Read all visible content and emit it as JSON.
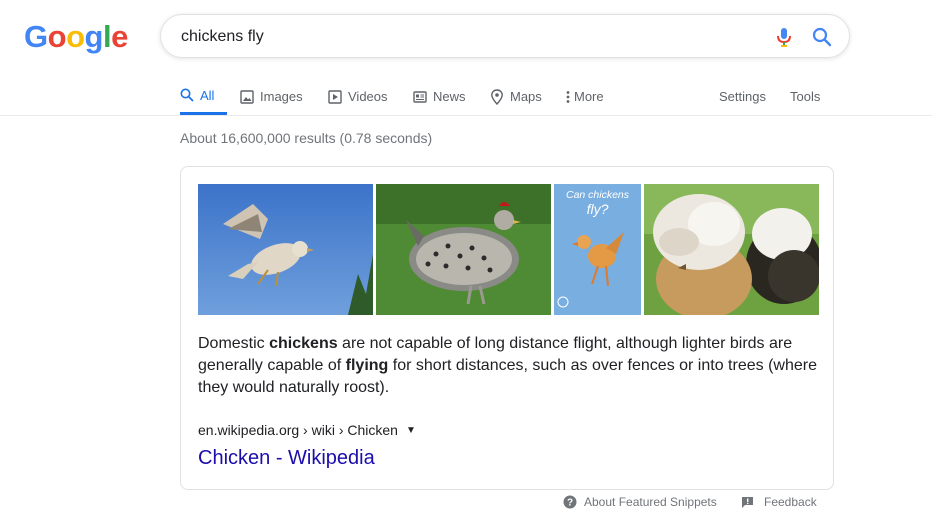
{
  "logo": {
    "text": "Google",
    "letters": [
      "G",
      "o",
      "o",
      "g",
      "l",
      "e"
    ],
    "colors": [
      "#4285F4",
      "#EA4335",
      "#FBBC05",
      "#4285F4",
      "#34A853",
      "#EA4335"
    ]
  },
  "search": {
    "query": "chickens fly",
    "mic_icon": "microphone-icon",
    "search_icon": "magnifier-icon"
  },
  "tabs": [
    {
      "label": "All",
      "icon": "search-icon",
      "active": true
    },
    {
      "label": "Images",
      "icon": "image-icon"
    },
    {
      "label": "Videos",
      "icon": "play-icon"
    },
    {
      "label": "News",
      "icon": "newspaper-icon"
    },
    {
      "label": "Maps",
      "icon": "map-pin-icon"
    },
    {
      "label": "More",
      "icon": "more-vertical-icon"
    }
  ],
  "tools": {
    "settings": "Settings",
    "tools": "Tools"
  },
  "results": {
    "stats": "About 16,600,000 results (0.78 seconds)",
    "featured_snippet": {
      "images": [
        "chicken-flying-sky",
        "speckled-hen-grass",
        "can-chickens-fly-illustration",
        "fluffy-crested-chickens"
      ],
      "image_overlay_text": "Can chickens fly?",
      "text_parts": {
        "p1": "Domestic ",
        "b1": "chickens",
        "p2": " are not capable of long distance flight, although lighter birds are generally capable of ",
        "b2": "flying",
        "p3": " for short distances, such as over fences or into trees (where they would naturally roost)."
      },
      "cite": "en.wikipedia.org › wiki › Chicken",
      "title": "Chicken - Wikipedia"
    }
  },
  "footer": {
    "about": "About Featured Snippets",
    "feedback": "Feedback"
  },
  "colors": {
    "accent": "#1a73e8",
    "link": "#1a0dab",
    "muted": "#70757a",
    "border": "#dfe1e5"
  }
}
